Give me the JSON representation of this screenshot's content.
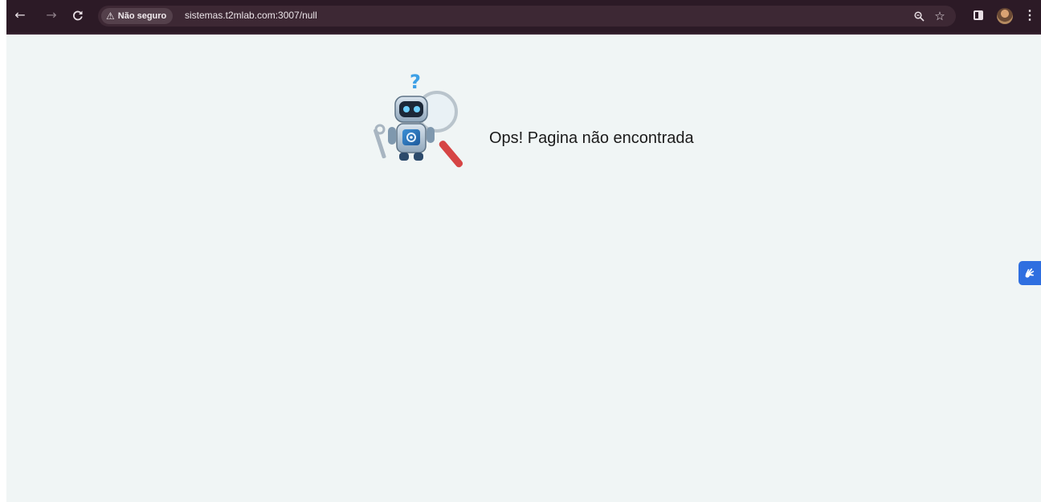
{
  "browser": {
    "security_label": "Não seguro",
    "url": "sistemas.t2mlab.com:3007/null",
    "icons": {
      "back": "arrow-left-icon",
      "forward": "arrow-right-icon",
      "reload": "reload-icon",
      "warning": "warning-icon",
      "zoom": "zoom-icon",
      "bookmark": "star-icon",
      "side_panel": "side-panel-icon",
      "profile": "avatar",
      "menu": "kebab-menu-icon"
    },
    "colors": {
      "toolbar": "#2c1a26",
      "omnibox": "#3d2834"
    }
  },
  "page": {
    "message": "Ops! Pagina não encontrada",
    "illustration": "robot-with-magnifying-glass",
    "background": "#f0f5f5",
    "accessibility_button_color": "#2f6fe0"
  }
}
